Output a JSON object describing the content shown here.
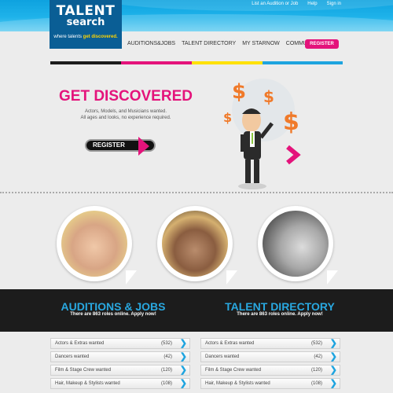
{
  "brand": {
    "logo_line1": "TALENT",
    "logo_line2": "search",
    "tagline_pre": "where talents",
    "tagline_post": "get discovered."
  },
  "top_links": [
    "List an Audition or Job",
    "Help",
    "Sign in"
  ],
  "nav": {
    "items": [
      "AUDITIONS&JOBS",
      "TALENT DIRECTORY",
      "MY STARNOW",
      "COMMUNITY"
    ],
    "register_label": "REGISTER"
  },
  "colors": {
    "accent": "#e4137b",
    "blue": "#29a8e0",
    "stripe": [
      "#1c1c1c",
      "#e4137b",
      "#ffe100",
      "#1ea4df"
    ]
  },
  "hero": {
    "title": "GET DISCOVERED",
    "sub_line1": "Actors, Models, and Musicians wanted.",
    "sub_line2": "All ages and looks, no experience required.",
    "button_label": "REGISTER"
  },
  "sections": [
    {
      "title": "AUDITIONS & JOBS",
      "subtitle": "There are 863 roles online. Apply now!"
    },
    {
      "title": "TALENT DIRECTORY",
      "subtitle": "There are 863 roles online. Apply now!"
    }
  ],
  "lists": [
    [
      {
        "label": "Actors & Extras wanted",
        "count": "(532)"
      },
      {
        "label": "Dancers wanted",
        "count": "(42)"
      },
      {
        "label": "Film & Stage Crew wanted",
        "count": "(120)"
      },
      {
        "label": "Hair, Makeup & Stylists wanted",
        "count": "(108)"
      }
    ],
    [
      {
        "label": "Actors & Extras wanted",
        "count": "(532)"
      },
      {
        "label": "Dancers wanted",
        "count": "(42)"
      },
      {
        "label": "Film & Stage Crew wanted",
        "count": "(120)"
      },
      {
        "label": "Hair, Makeup & Stylists wanted",
        "count": "(108)"
      }
    ]
  ]
}
